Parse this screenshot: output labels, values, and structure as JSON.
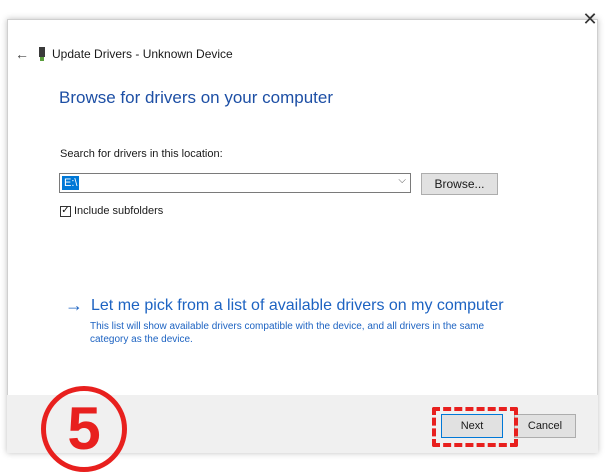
{
  "dialog": {
    "title": "Update Drivers - Unknown Device",
    "close_icon": "close-icon",
    "back_icon": "back-arrow-icon",
    "device_icon": "device-icon"
  },
  "main": {
    "heading": "Browse for drivers on your computer",
    "location_label": "Search for drivers in this location:",
    "location_value": "E:\\",
    "browse_label": "Browse...",
    "include_subfolders_label": "Include subfolders",
    "include_subfolders_checked": true,
    "pick_link_text": "Let me pick from a list of available drivers on my computer",
    "pick_link_desc": "This list will show available drivers compatible with the device, and all drivers in the same category as the device."
  },
  "footer": {
    "next_label": "Next",
    "cancel_label": "Cancel"
  },
  "annotation": {
    "step_number": "5",
    "color": "#e8201e"
  },
  "colors": {
    "accent": "#0078d7",
    "heading": "#1d4fa5",
    "link": "#1d63c2"
  }
}
